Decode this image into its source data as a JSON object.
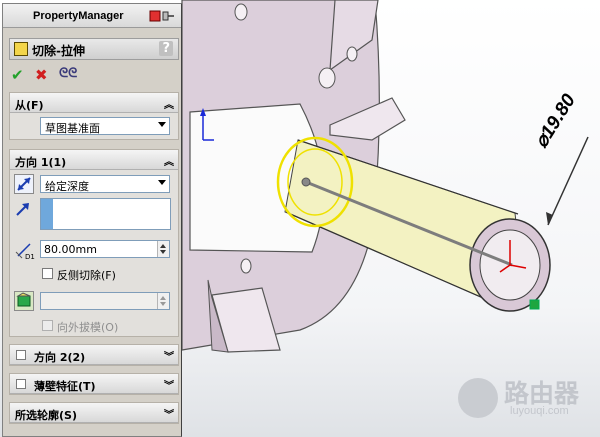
{
  "property_manager": {
    "title": "PropertyManager",
    "feature": "切除-拉伸",
    "help_label": "?",
    "actions": [
      {
        "icon": "check-icon",
        "color": "#22a12a"
      },
      {
        "icon": "close-icon",
        "color": "#d11f1f"
      },
      {
        "icon": "preview-glasses-icon",
        "color": "#3a3a7a"
      }
    ],
    "from": {
      "header": "从(F)",
      "value": "草图基准面"
    },
    "direction1": {
      "header": "方向 1(1)",
      "end_condition": "给定深度",
      "depth": "80.00mm",
      "flip_side_label": "反侧切除(F)",
      "draft_label": "向外拔模(O)"
    },
    "direction2": {
      "header": "方向 2(2)"
    },
    "thin_feature": {
      "header": "薄壁特征(T)"
    },
    "selected_contours": {
      "header": "所选轮廓(S)"
    }
  },
  "viewport": {
    "dimension_label": "⌀19.80",
    "part_color": "#ddd0dc",
    "cylinder_color": "#f3f2c2",
    "highlight_color": "#f0e000",
    "background_color": "#ffffff"
  },
  "watermark": {
    "brand": "路由器",
    "url": "luyouqi.com"
  }
}
